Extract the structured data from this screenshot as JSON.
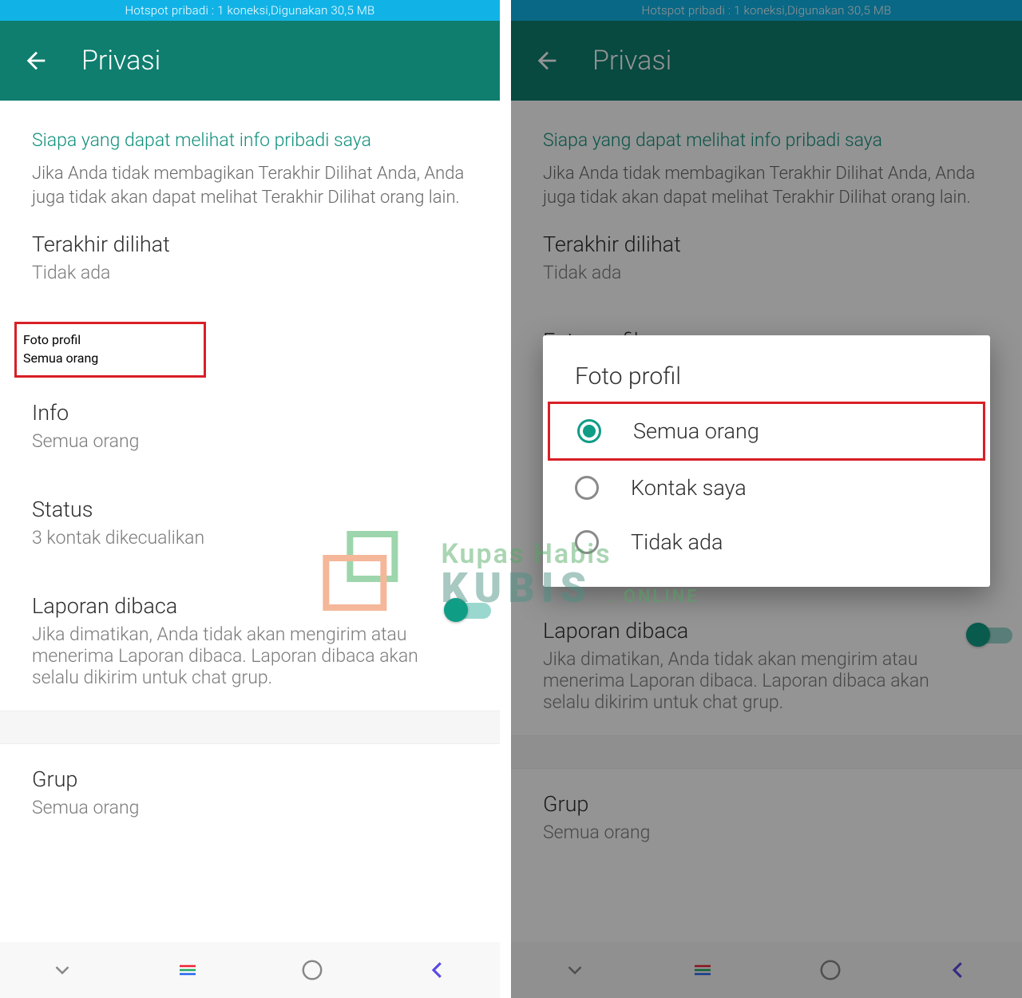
{
  "statusbar_text": "Hotspot pribadi : 1 koneksi,Digunakan 30,5 MB",
  "appbar_title": "Privasi",
  "section_title": "Siapa yang dapat melihat info pribadi saya",
  "section_desc": "Jika Anda tidak membagikan Terakhir Dilihat Anda, Anda juga tidak akan dapat melihat Terakhir Dilihat orang lain.",
  "items": {
    "last_seen": {
      "title": "Terakhir dilihat",
      "sub": "Tidak ada"
    },
    "photo": {
      "title": "Foto profil",
      "sub": "Semua orang"
    },
    "info": {
      "title": "Info",
      "sub": "Semua orang"
    },
    "status": {
      "title": "Status",
      "sub": "3 kontak dikecualikan"
    },
    "read": {
      "title": "Laporan dibaca",
      "sub": "Jika dimatikan, Anda tidak akan mengirim atau menerima Laporan dibaca. Laporan dibaca akan selalu dikirim untuk chat grup."
    },
    "group": {
      "title": "Grup",
      "sub": "Semua orang"
    }
  },
  "dialog": {
    "title": "Foto profil",
    "opt1": "Semua orang",
    "opt2": "Kontak saya",
    "opt3": "Tidak ada"
  },
  "watermark": {
    "line1": "Kupas Habis",
    "line2": "KUBIS",
    "suffix": ". ONLINE"
  }
}
